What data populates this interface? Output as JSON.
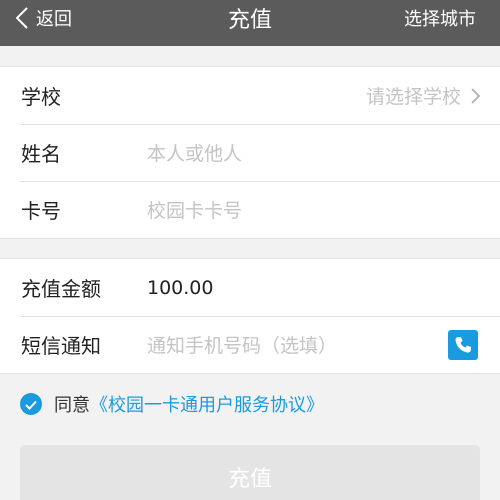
{
  "navbar": {
    "back_label": "返回",
    "title": "充值",
    "city_label": "选择城市",
    "background": "#5b5b5b"
  },
  "form": {
    "school": {
      "label": "学校",
      "placeholder": "请选择学校"
    },
    "name": {
      "label": "姓名",
      "placeholder": "本人或他人"
    },
    "card": {
      "label": "卡号",
      "placeholder": "校园卡卡号"
    },
    "amount": {
      "label": "充值金额",
      "value": "100.00"
    },
    "sms": {
      "label": "短信通知",
      "placeholder": "通知手机号码（选填）",
      "icon": "contacts-icon"
    }
  },
  "agreement": {
    "checked": true,
    "prefix": "同意",
    "link": "《校园一卡通用户服务协议》"
  },
  "submit": {
    "label": "充值"
  },
  "colors": {
    "accent": "#1a9be0",
    "placeholder": "#c4c4c4",
    "page_background": "#f2f2f2",
    "button_disabled": "#e4e4e4"
  }
}
